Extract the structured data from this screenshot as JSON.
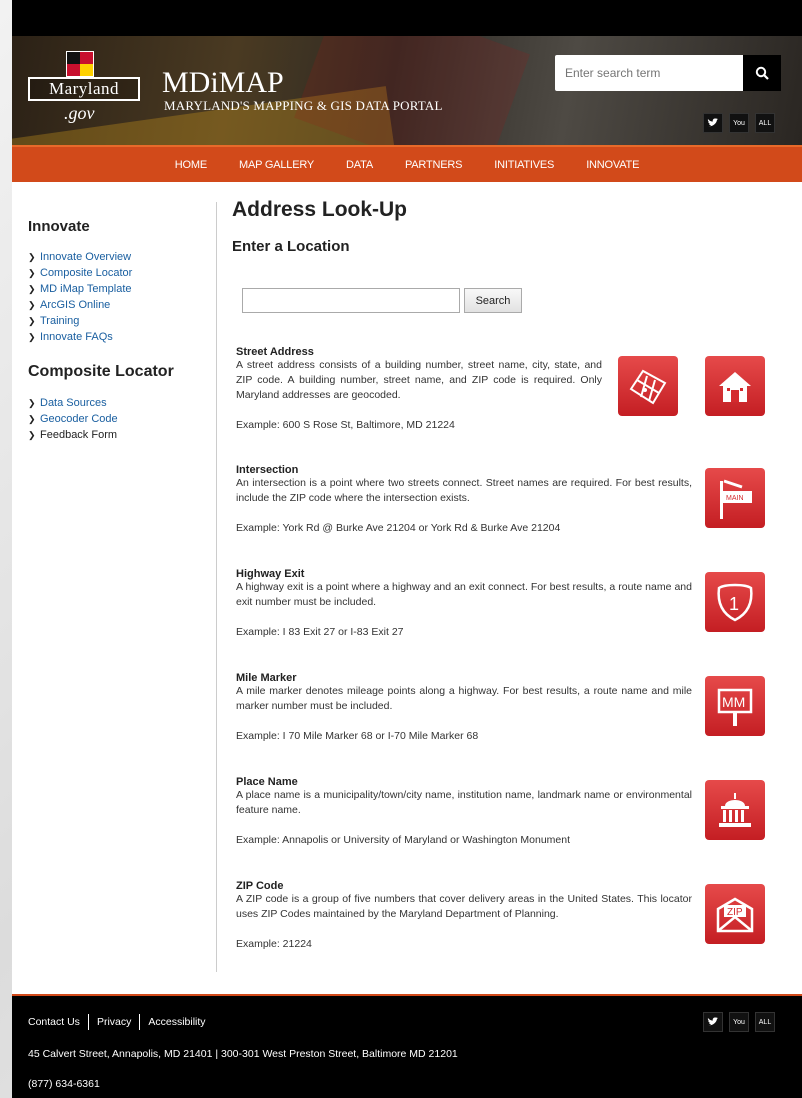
{
  "header": {
    "logo_main": "Maryland",
    "logo_gov": ".gov",
    "site_title": "MDiMAP",
    "site_subtitle": "MARYLAND'S MAPPING & GIS DATA PORTAL",
    "search_placeholder": "Enter search term",
    "social": [
      "twitter-icon",
      "youtube-icon",
      "all-icon"
    ],
    "social_labels": {
      "all": "ALL",
      "youtube": "You"
    }
  },
  "nav": {
    "items": [
      "HOME",
      "MAP GALLERY",
      "DATA",
      "PARTNERS",
      "INITIATIVES",
      "INNOVATE"
    ]
  },
  "sidebar": {
    "heading1": "Innovate",
    "group1": [
      "Innovate Overview",
      "Composite Locator",
      "MD iMap Template",
      "ArcGIS Online",
      "Training",
      "Innovate FAQs"
    ],
    "heading2": "Composite Locator",
    "group2": [
      "Data Sources",
      "Geocoder Code",
      "Feedback Form"
    ]
  },
  "main": {
    "title": "Address Look-Up",
    "subtitle": "Enter a Location",
    "search_button": "Search",
    "sections": [
      {
        "title": "Street Address",
        "desc": "A street address consists of a building number, street name, city, state, and ZIP code. A building number, street name, and ZIP code is required. Only Maryland addresses are geocoded.",
        "example": "Example: 600 S Rose St, Baltimore, MD 21224",
        "icons": [
          "map-parcel-icon",
          "house-icon"
        ]
      },
      {
        "title": "Intersection",
        "desc": "An intersection is a point where two streets connect. Street names are required. For best results, include the ZIP code where the intersection exists.",
        "example": "Example: York Rd @ Burke Ave 21204 or York Rd & Burke Ave 21204",
        "icons": [
          "street-sign-icon"
        ],
        "icon_label": "MAIN"
      },
      {
        "title": "Highway Exit",
        "desc": "A highway exit is a point where a highway and an exit connect. For best results, a route name and exit number must be included.",
        "example": "Example: I 83 Exit 27 or I-83 Exit 27",
        "icons": [
          "interstate-shield-icon"
        ],
        "icon_label": "1"
      },
      {
        "title": "Mile Marker",
        "desc": "A mile marker denotes mileage points along a highway. For best results, a route name and mile marker number must be included.",
        "example": "Example: I 70 Mile Marker 68 or I-70 Mile Marker 68",
        "icons": [
          "mile-marker-icon"
        ],
        "icon_label": "MM"
      },
      {
        "title": "Place Name",
        "desc": "A place name is a municipality/town/city name, institution name, landmark name or environmental feature name.",
        "example": "Example: Annapolis or University of Maryland or Washington Monument",
        "icons": [
          "capitol-building-icon"
        ]
      },
      {
        "title": "ZIP Code",
        "desc": "A ZIP code is a group of five numbers that cover delivery areas in the United States. This locator uses ZIP Codes maintained by the Maryland Department of Planning.",
        "example": "Example: 21224",
        "icons": [
          "zip-envelope-icon"
        ],
        "icon_label": "ZIP"
      }
    ]
  },
  "footer": {
    "links": [
      "Contact Us",
      "Privacy",
      "Accessibility"
    ],
    "address": "45 Calvert Street, Annapolis, MD 21401 | 300-301 West Preston Street, Baltimore MD 21201",
    "phone": "(877) 634-6361"
  },
  "colors": {
    "nav_bg": "#d24a1a",
    "icon_red": "#d42a2e",
    "link_blue": "#1a5fa0",
    "footer_bg": "#000000"
  }
}
